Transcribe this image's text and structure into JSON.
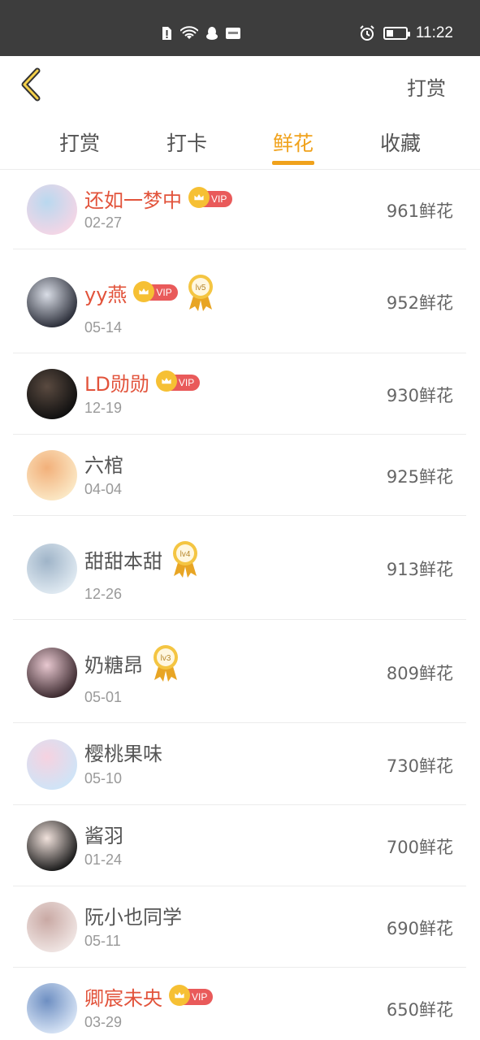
{
  "status_bar": {
    "time": "11:22"
  },
  "header": {
    "action_label": "打赏"
  },
  "tabs": [
    {
      "label": "打赏",
      "active": false
    },
    {
      "label": "打卡",
      "active": false
    },
    {
      "label": "鲜花",
      "active": true
    },
    {
      "label": "收藏",
      "active": false
    }
  ],
  "accent_color": "#f0a21c",
  "vip_name_color": "#e2533b",
  "vip_badge_text": "VIP",
  "rows": [
    {
      "name": "还如一梦中",
      "date": "02-27",
      "amount": "961鲜花",
      "vip": true,
      "level": null
    },
    {
      "name": "yy燕",
      "date": "05-14",
      "amount": "952鲜花",
      "vip": true,
      "level": "lv5"
    },
    {
      "name": "LD勋勋",
      "date": "12-19",
      "amount": "930鲜花",
      "vip": true,
      "level": null
    },
    {
      "name": "六棺",
      "date": "04-04",
      "amount": "925鲜花",
      "vip": false,
      "level": null
    },
    {
      "name": "甜甜本甜",
      "date": "12-26",
      "amount": "913鲜花",
      "vip": false,
      "level": "lv4"
    },
    {
      "name": "奶糖昂",
      "date": "05-01",
      "amount": "809鲜花",
      "vip": false,
      "level": "lv3"
    },
    {
      "name": "樱桃果味",
      "date": "05-10",
      "amount": "730鲜花",
      "vip": false,
      "level": null
    },
    {
      "name": "酱羽",
      "date": "01-24",
      "amount": "700鲜花",
      "vip": false,
      "level": null
    },
    {
      "name": "阮小也同学",
      "date": "05-11",
      "amount": "690鲜花",
      "vip": false,
      "level": null
    },
    {
      "name": "卿宸未央",
      "date": "03-29",
      "amount": "650鲜花",
      "vip": true,
      "level": null
    }
  ]
}
